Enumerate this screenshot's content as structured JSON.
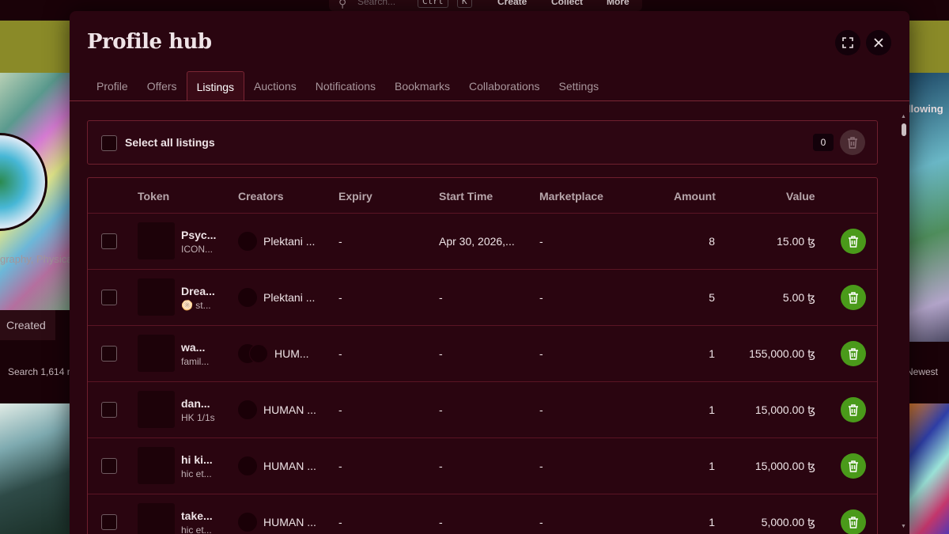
{
  "background": {
    "search_placeholder": "Search...",
    "kbd_ctrl": "Ctrl",
    "kbd_k": "K",
    "nav": [
      "Create",
      "Collect",
      "More"
    ],
    "profile_tags_text": "graphy, Physica",
    "tab_created": "Created",
    "search_count": "Search 1,614 r",
    "following_text": "ollowing",
    "sort_text": "Newest"
  },
  "modal": {
    "title": "Profile hub",
    "tabs": [
      {
        "label": "Profile"
      },
      {
        "label": "Offers"
      },
      {
        "label": "Listings"
      },
      {
        "label": "Auctions"
      },
      {
        "label": "Notifications"
      },
      {
        "label": "Bookmarks"
      },
      {
        "label": "Collaborations"
      },
      {
        "label": "Settings"
      }
    ],
    "active_tab": "Listings",
    "select_all_label": "Select all listings",
    "selected_count": "0"
  },
  "table": {
    "headers": {
      "token": "Token",
      "creators": "Creators",
      "expiry": "Expiry",
      "start_time": "Start Time",
      "marketplace": "Marketplace",
      "amount": "Amount",
      "value": "Value"
    },
    "rows": [
      {
        "name": "Psyc...",
        "sub": "ICON...",
        "creator": "Plektani ...",
        "avatars": 1,
        "expiry": "-",
        "start": "Apr 30, 2026,...",
        "market": "-",
        "amount": "8",
        "value": "15.00 ꜩ"
      },
      {
        "name": "Drea...",
        "sub": "🫓 st...",
        "creator": "Plektani ...",
        "avatars": 1,
        "expiry": "-",
        "start": "-",
        "market": "-",
        "amount": "5",
        "value": "5.00 ꜩ"
      },
      {
        "name": "wa...",
        "sub": "famil...",
        "creator": "HUM...",
        "avatars": 2,
        "expiry": "-",
        "start": "-",
        "market": "-",
        "amount": "1",
        "value": "155,000.00 ꜩ"
      },
      {
        "name": "dan...",
        "sub": "HK 1/1s",
        "creator": "HUMAN ...",
        "avatars": 1,
        "expiry": "-",
        "start": "-",
        "market": "-",
        "amount": "1",
        "value": "15,000.00 ꜩ"
      },
      {
        "name": "hi ki...",
        "sub": "hic et...",
        "creator": "HUMAN ...",
        "avatars": 1,
        "expiry": "-",
        "start": "-",
        "market": "-",
        "amount": "1",
        "value": "15,000.00 ꜩ"
      },
      {
        "name": "take...",
        "sub": "hic et...",
        "creator": "HUMAN ...",
        "avatars": 1,
        "expiry": "-",
        "start": "-",
        "market": "-",
        "amount": "1",
        "value": "5,000.00 ꜩ"
      }
    ]
  },
  "colors": {
    "modal_bg": "#2a0510",
    "accent_border": "#7a2634",
    "delete_green": "#4a9a1a",
    "banner_olive": "#8a8a28"
  },
  "icons": {
    "expand": "expand-icon",
    "close": "close-icon",
    "delete": "trash-icon",
    "search": "search-icon"
  }
}
